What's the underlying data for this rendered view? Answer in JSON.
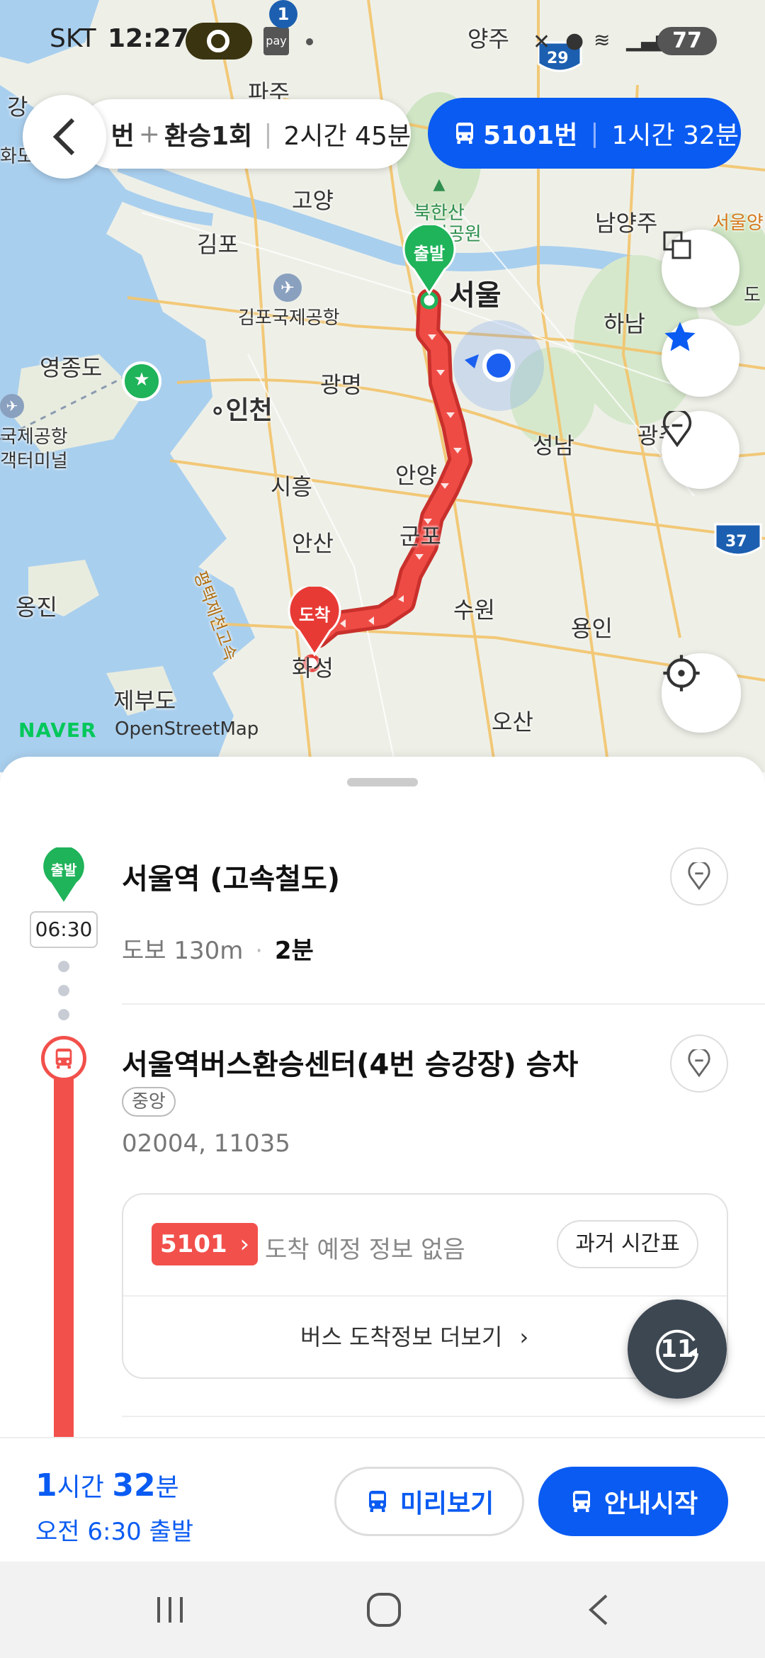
{
  "status_bar": {
    "carrier": "SKT",
    "time": "12:27",
    "pay_label": "pay",
    "notif_count": "1",
    "battery": "77",
    "route_shield_29": "29",
    "route_shield_37": "37"
  },
  "route_header": {
    "alt_route_fragment": "번",
    "alt_route_transfer": "환승1회",
    "alt_route_duration": "2시간 45분",
    "selected_bus": "5101번",
    "selected_duration": "1시간 32분"
  },
  "map": {
    "labels": {
      "paju": "파주",
      "yangju": "양주",
      "goyang": "고양",
      "bukhansan": "북한산",
      "gukrip": "국립공원",
      "namyangju": "남양주",
      "seoul_right": "서울양",
      "gimpo": "김포",
      "seoul": "서울",
      "gimpo_airport": "김포국제공항",
      "hanam": "하남",
      "yeongjongdo": "영종도",
      "gwangmyeong": "광명",
      "incheon": "인천",
      "airport_left": "국제공항",
      "terminal_left": "객터미널",
      "seongnam": "성남",
      "gwangju_partial": "광주",
      "siheung": "시흥",
      "anyang": "안양",
      "ansan": "안산",
      "gunpo": "군포",
      "ongjin": "옹진",
      "suwon": "수원",
      "yongin": "용인",
      "hwaseong": "화성",
      "jebudo": "제부도",
      "osan": "오산",
      "expressway": "평택제천고속",
      "gang_partial": "강",
      "hwado_partial": "화도",
      "do_partial": "도"
    },
    "start_pin": "출발",
    "end_pin": "도착",
    "attribution_brand": "NAVER",
    "attribution_osm": "OpenStreetMap"
  },
  "steps": {
    "start_pin": "출발",
    "start_time": "06:30",
    "start_title": "서울역 (고속철도)",
    "walk_text": "도보 130m",
    "walk_sep": "·",
    "walk_min": "2분",
    "stop_title": "서울역버스환승센터(4번 승강장) 승차",
    "stop_badge": "중앙",
    "stop_ids": "02004, 11035",
    "bus_number": "5101",
    "bus_arrival": "도착 예정 정보 없음",
    "timetable_btn": "과거 시간표",
    "more_arrival": "버스 도착정보 더보기",
    "refresh_count": "11"
  },
  "action_bar": {
    "dur_hours": "1",
    "dur_hours_unit": "시간",
    "dur_minutes": "32",
    "dur_minutes_unit": "분",
    "departure": "오전 6:30 출발",
    "preview_btn": "미리보기",
    "start_btn": "안내시작"
  },
  "colors": {
    "primary_blue": "#0a5bf2",
    "route_red": "#f2504b",
    "start_green": "#1fb35a"
  }
}
